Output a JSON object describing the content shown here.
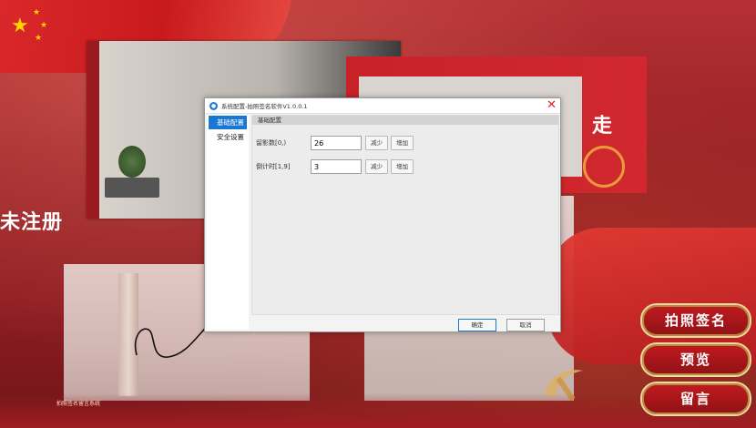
{
  "background": {
    "side_text": "未注册",
    "top_card_text": "走",
    "logo_small_text": "拍照签名留言系统"
  },
  "side_buttons": [
    {
      "label": "拍照签名"
    },
    {
      "label": "预览"
    },
    {
      "label": "留言"
    }
  ],
  "dialog": {
    "title": "系统配置-拍照签名软件V1.0.0.1",
    "nav": [
      {
        "label": "基础配置",
        "active": true
      },
      {
        "label": "安全设置",
        "active": false
      }
    ],
    "group_title": "基础配置",
    "fields": [
      {
        "label": "留影数[0,)",
        "value": "26",
        "dec_label": "减少",
        "inc_label": "增加"
      },
      {
        "label": "倒计时[1,9]",
        "value": "3",
        "dec_label": "减少",
        "inc_label": "增加"
      }
    ],
    "ok_label": "确定",
    "cancel_label": "取消"
  },
  "colors": {
    "accent": "#1877d2",
    "close": "#e02020",
    "background_red": "#9a2226",
    "gold": "#f2d7a0"
  }
}
